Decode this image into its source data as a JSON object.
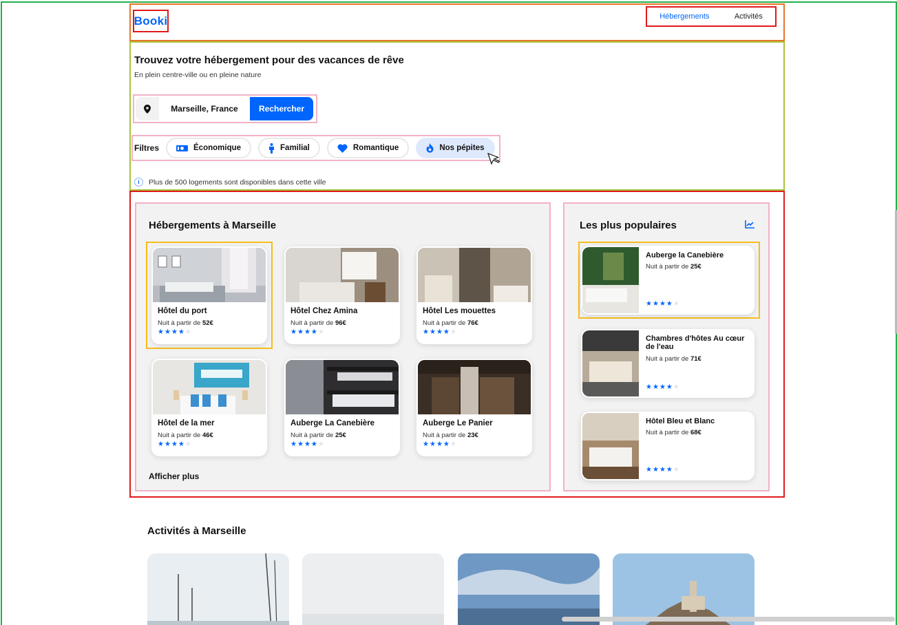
{
  "header": {
    "logo": "Booki",
    "nav": [
      {
        "label": "Hébergements"
      },
      {
        "label": "Activités"
      }
    ]
  },
  "hero": {
    "title": "Trouvez votre hébergement pour des vacances de rêve",
    "subtitle": "En plein centre-ville ou en pleine nature",
    "search": {
      "value": "Marseille, France",
      "button": "Rechercher"
    },
    "filters": {
      "label": "Filtres",
      "chips": [
        {
          "label": "Économique",
          "icon": "money-icon",
          "selected": false
        },
        {
          "label": "Familial",
          "icon": "person-icon",
          "selected": false
        },
        {
          "label": "Romantique",
          "icon": "heart-icon",
          "selected": false
        },
        {
          "label": "Nos pépites",
          "icon": "fire-icon",
          "selected": true
        }
      ]
    },
    "info": "Plus de 500 logements sont disponibles dans cette ville"
  },
  "lodgings": {
    "title": "Hébergements à Marseille",
    "price_prefix": "Nuit à partir de ",
    "show_more": "Afficher plus",
    "items": [
      {
        "name": "Hôtel du port",
        "price": "52€",
        "rating": 4
      },
      {
        "name": "Hôtel Chez Amina",
        "price": "96€",
        "rating": 4
      },
      {
        "name": "Hôtel Les mouettes",
        "price": "76€",
        "rating": 4
      },
      {
        "name": "Hôtel de la mer",
        "price": "46€",
        "rating": 4
      },
      {
        "name": "Auberge La Canebière",
        "price": "25€",
        "rating": 4
      },
      {
        "name": "Auberge Le Panier",
        "price": "23€",
        "rating": 4
      }
    ]
  },
  "popular": {
    "title": "Les plus populaires",
    "icon": "trend-chart-icon",
    "price_prefix": "Nuit à partir de ",
    "items": [
      {
        "name": "Auberge la Canebière",
        "price": "25€",
        "rating": 4
      },
      {
        "name": "Chambres d'hôtes Au cœur de l'eau",
        "price": "71€",
        "rating": 4
      },
      {
        "name": "Hôtel Bleu et Blanc",
        "price": "68€",
        "rating": 4
      }
    ]
  },
  "activities": {
    "title": "Activités à Marseille"
  },
  "colors": {
    "brand": "#0065fc",
    "chip_selected": "#dee9fc",
    "section_bg": "#f2f2f2"
  }
}
